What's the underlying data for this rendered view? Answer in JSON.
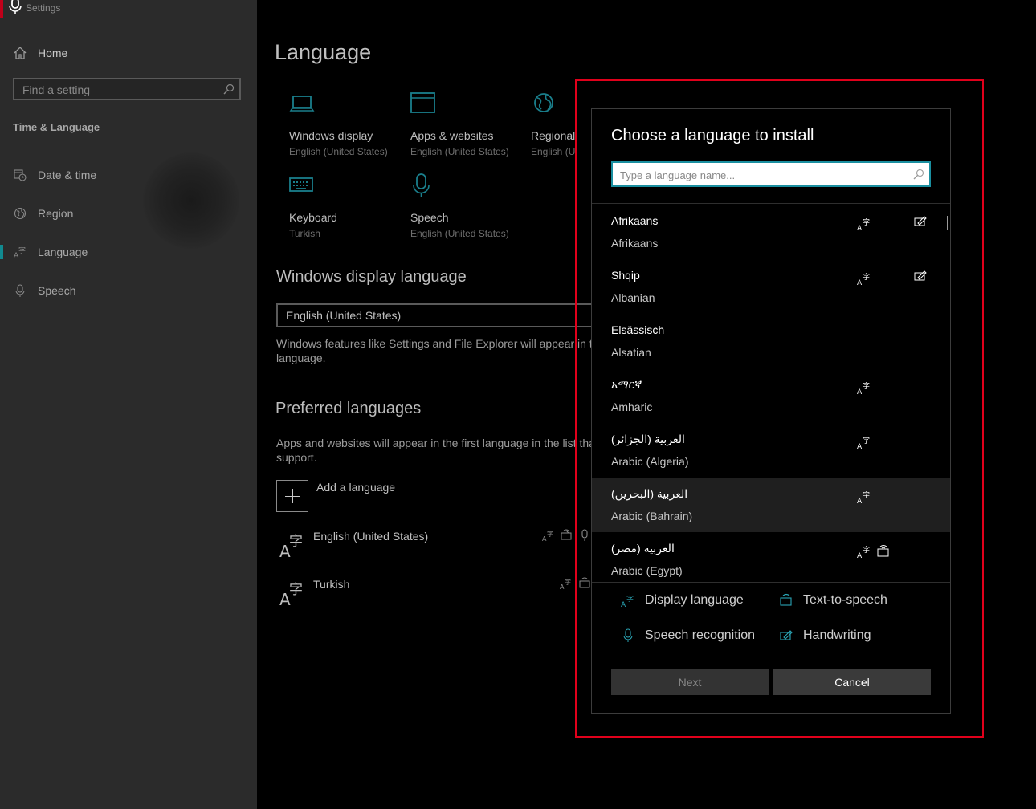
{
  "window": {
    "title": "Settings"
  },
  "sidebar": {
    "home_label": "Home",
    "search_placeholder": "Find a setting",
    "section_title": "Time & Language",
    "items": [
      {
        "label": "Date & time",
        "icon": "calendar-clock-icon"
      },
      {
        "label": "Region",
        "icon": "globe-icon"
      },
      {
        "label": "Language",
        "icon": "language-icon",
        "selected": true
      },
      {
        "label": "Speech",
        "icon": "microphone-icon"
      }
    ]
  },
  "main": {
    "page_title": "Language",
    "tiles": [
      {
        "name": "Windows display",
        "sub": "English (United States)",
        "icon": "laptop-icon"
      },
      {
        "name": "Apps & websites",
        "sub": "English (United States)",
        "icon": "browser-window-icon"
      },
      {
        "name": "Regional for",
        "sub": "English (Unite",
        "icon": "globe-icon"
      },
      {
        "name": "Keyboard",
        "sub": "Turkish",
        "icon": "keyboard-icon"
      },
      {
        "name": "Speech",
        "sub": "English (United States)",
        "icon": "microphone-icon"
      }
    ],
    "display_language_heading": "Windows display language",
    "display_language_value": "English (United States)",
    "display_language_desc_1": "Windows features like Settings and File Explorer will appear in th",
    "display_language_desc_2": "language.",
    "preferred_heading": "Preferred languages",
    "preferred_desc_1": "Apps and websites will appear in the first language in the list tha",
    "preferred_desc_2": "support.",
    "add_language_label": "Add a language",
    "preferred": [
      {
        "name": "English (United States)"
      },
      {
        "name": "Turkish"
      }
    ]
  },
  "dialog": {
    "title": "Choose a language to install",
    "search_placeholder": "Type a language name...",
    "languages": [
      {
        "native": "Afrikaans",
        "english": "Afrikaans",
        "display": true,
        "handwriting": true
      },
      {
        "native": "Shqip",
        "english": "Albanian",
        "display": true,
        "handwriting": true
      },
      {
        "native": "Elsässisch",
        "english": "Alsatian"
      },
      {
        "native": "አማርኛ",
        "english": "Amharic",
        "display": true
      },
      {
        "native": "العربية (الجزائر)",
        "english": "Arabic (Algeria)",
        "display": true
      },
      {
        "native": "العربية (البحرين)",
        "english": "Arabic (Bahrain)",
        "display": true,
        "selected": true
      },
      {
        "native": "العربية (مصر)",
        "english": "Arabic (Egypt)",
        "display": true,
        "tts": true
      }
    ],
    "legend": {
      "display_language": "Display language",
      "text_to_speech": "Text-to-speech",
      "speech_recognition": "Speech recognition",
      "handwriting": "Handwriting"
    },
    "next_label": "Next",
    "cancel_label": "Cancel"
  },
  "colors": {
    "accent": "#1a8fa0",
    "highlight": "#e0001b"
  }
}
